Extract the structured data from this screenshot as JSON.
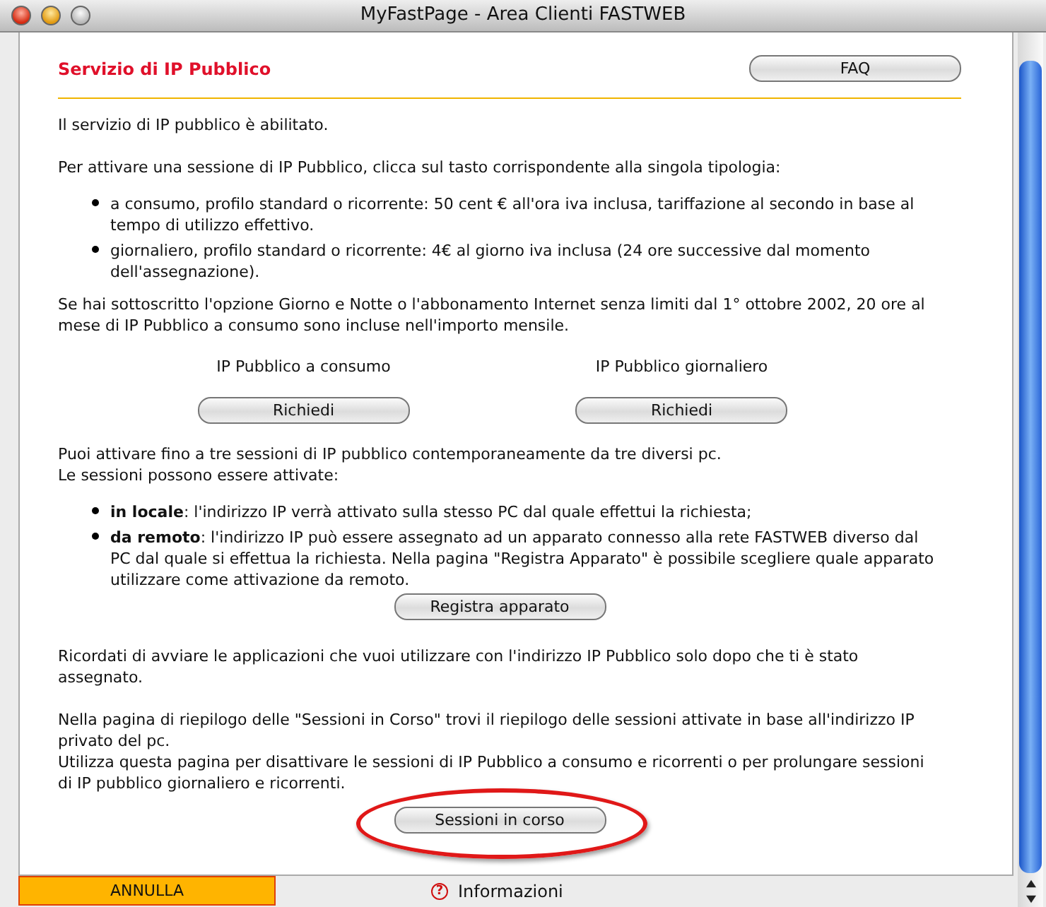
{
  "window": {
    "title": "MyFastPage - Area Clienti FASTWEB"
  },
  "header": {
    "title": "Servizio di IP Pubblico",
    "faq_button": "FAQ"
  },
  "blocks": [
    {
      "kind": "paragraph",
      "lines": [
        "Il servizio di IP pubblico è abilitato."
      ]
    },
    {
      "kind": "paragraph",
      "lines": [
        "Per attivare una sessione di IP Pubblico, clicca sul tasto corrispondente alla singola tipologia:"
      ]
    },
    {
      "kind": "bullets",
      "items": [
        "a consumo, profilo standard o ricorrente: 50 cent € all'ora iva inclusa, tariffazione al secondo in base al tempo di utilizzo effettivo.",
        "giornaliero, profilo standard o ricorrente: 4€ al giorno iva inclusa (24 ore successive dal momento dell'assegnazione)."
      ]
    },
    {
      "kind": "paragraph",
      "lines": [
        "Se hai sottoscritto l'opzione Giorno e Notte o l'abbonamento Internet senza limiti dal 1° ottobre 2002, 20 ore al mese di IP Pubblico a consumo sono incluse nell'importo mensile."
      ]
    },
    {
      "kind": "choices",
      "options": [
        {
          "label": "IP Pubblico a consumo",
          "button": "Richiedi"
        },
        {
          "label": "IP Pubblico giornaliero",
          "button": "Richiedi"
        }
      ]
    },
    {
      "kind": "paragraph",
      "lines": [
        "Puoi attivare fino a tre sessioni di IP pubblico contemporaneamente da tre diversi pc.",
        "Le sessioni possono essere attivate:"
      ]
    },
    {
      "kind": "bullets",
      "items": [
        "**in locale**: l'indirizzo IP verrà attivato sulla stesso PC dal quale effettui la richiesta;",
        "**da remoto**: l'indirizzo IP può essere assegnato ad un apparato connesso alla rete FASTWEB diverso dal PC dal quale si effettua la richiesta. Nella pagina \"Registra Apparato\" è possibile scegliere quale apparato utilizzare come attivazione da remoto."
      ]
    },
    {
      "kind": "button",
      "label": "Registra apparato",
      "highlighted": false
    },
    {
      "kind": "paragraph",
      "lines": [
        "Ricordati di avviare le applicazioni che vuoi utilizzare con l'indirizzo IP Pubblico solo dopo che ti è stato assegnato."
      ]
    },
    {
      "kind": "paragraph",
      "lines": [
        "Nella pagina di riepilogo delle \"Sessioni in Corso\" trovi il riepilogo delle sessioni attivate in base all'indirizzo IP privato del pc.",
        "Utilizza questa pagina per disattivare le sessioni di IP Pubblico a consumo e ricorrenti o per prolungare sessioni di IP pubblico giornaliero e ricorrenti."
      ]
    },
    {
      "kind": "button",
      "label": "Sessioni in corso",
      "highlighted": true
    }
  ],
  "footer": {
    "cancel_button": "ANNULLA",
    "info_tab": {
      "icon_text": "?",
      "label": "Informazioni"
    }
  }
}
